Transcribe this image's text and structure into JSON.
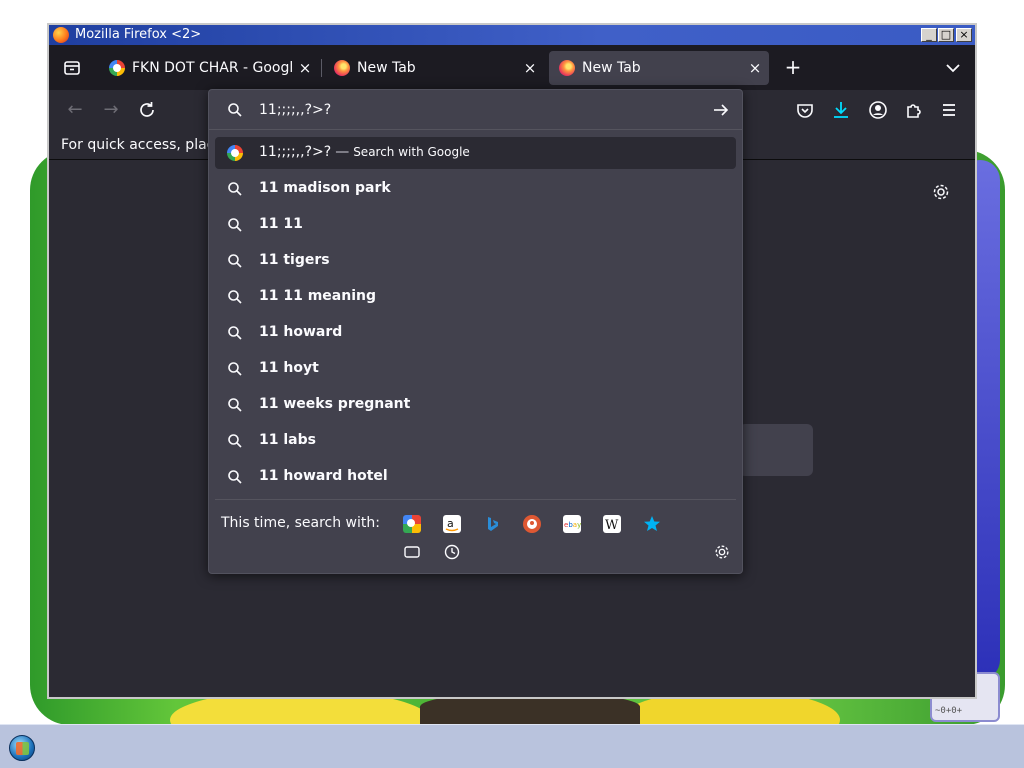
{
  "window": {
    "title": "Mozilla Firefox <2>",
    "controls": {
      "minimize": "_",
      "maximize": "□",
      "close": "×"
    }
  },
  "tabs": [
    {
      "title": "FKN DOT CHAR - Google",
      "favicon": "google-icon",
      "active": false
    },
    {
      "title": "New Tab",
      "favicon": "firefox-icon",
      "active": false
    },
    {
      "title": "New Tab",
      "favicon": "firefox-icon",
      "active": true
    }
  ],
  "tabbar": {
    "close_glyph": "×",
    "new_tab_glyph": "+"
  },
  "navbar": {
    "back_glyph": "←",
    "forward_glyph": "→"
  },
  "bookmarks_bar": {
    "text": "For quick access, plac"
  },
  "urlbar": {
    "value": "11;;;;,,?>?",
    "first_result": {
      "text": "11;;;;,,?>?",
      "separator": "—",
      "action": "Search with Google"
    },
    "suggestions": [
      "11 madison park",
      "11 11",
      "11 tigers",
      "11 11 meaning",
      "11 howard",
      "11 hoyt",
      "11 weeks pregnant",
      "11 labs",
      "11 howard hotel"
    ],
    "one_off_label": "This time, search with:",
    "engines": [
      "Google",
      "Amazon",
      "Bing",
      "DuckDuckGo",
      "eBay",
      "Wikipedia",
      "Bookmarks",
      "Tabs",
      "History"
    ]
  },
  "wallpaper": {
    "sign_text": "~0+0+"
  },
  "colors": {
    "toolbar": "#2b2a33",
    "tabbar": "#1c1b22",
    "popup": "#42414d",
    "text": "#fbfbfe",
    "accent": "#00ddff"
  }
}
